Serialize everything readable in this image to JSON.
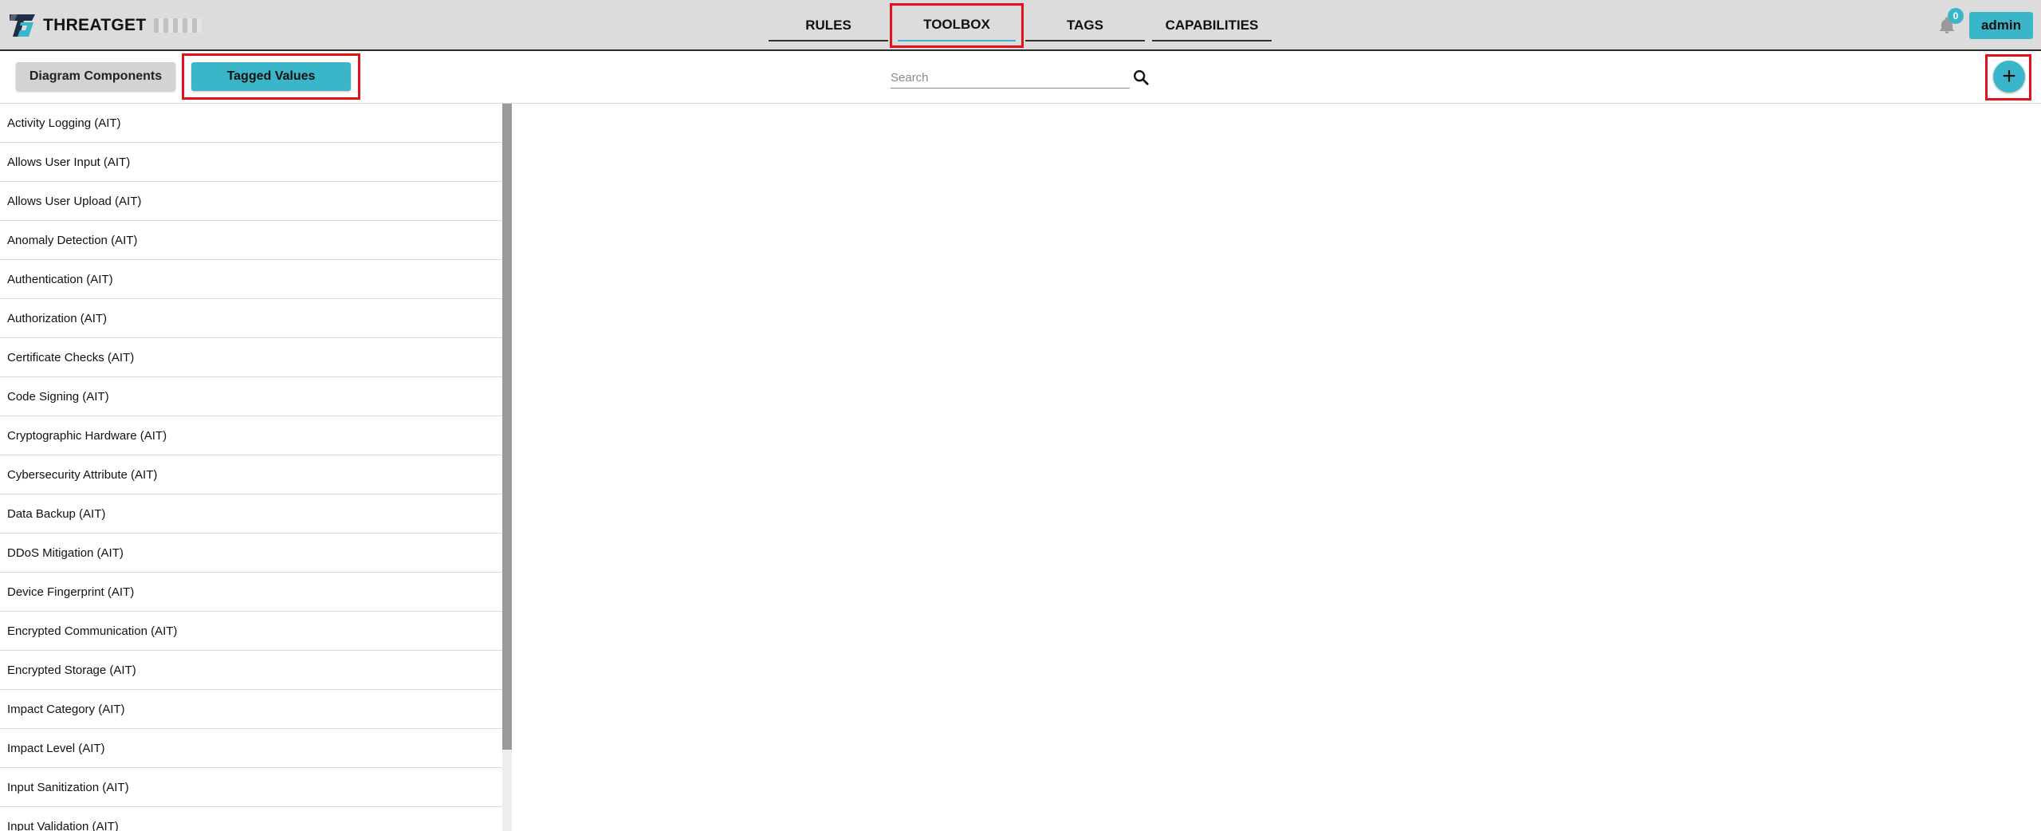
{
  "app": {
    "name": "THREATGET"
  },
  "nav": {
    "tabs": [
      {
        "label": "RULES",
        "active": false
      },
      {
        "label": "TOOLBOX",
        "active": true
      },
      {
        "label": "TAGS",
        "active": false
      },
      {
        "label": "CAPABILITIES",
        "active": false
      }
    ]
  },
  "header": {
    "notification_count": "0",
    "user_label": "admin"
  },
  "toolbar": {
    "tabs": [
      {
        "label": "Diagram Components",
        "active": false
      },
      {
        "label": "Tagged Values",
        "active": true
      }
    ],
    "search_placeholder": "Search",
    "add_label": "+"
  },
  "tagged_values": {
    "items": [
      "Activity Logging (AIT)",
      "Allows User Input (AIT)",
      "Allows User Upload (AIT)",
      "Anomaly Detection (AIT)",
      "Authentication (AIT)",
      "Authorization (AIT)",
      "Certificate Checks (AIT)",
      "Code Signing (AIT)",
      "Cryptographic Hardware (AIT)",
      "Cybersecurity Attribute (AIT)",
      "Data Backup (AIT)",
      "DDoS Mitigation (AIT)",
      "Device Fingerprint (AIT)",
      "Encrypted Communication (AIT)",
      "Encrypted Storage (AIT)",
      "Impact Category (AIT)",
      "Impact Level (AIT)",
      "Input Sanitization (AIT)",
      "Input Validation (AIT)"
    ]
  },
  "colors": {
    "accent": "#3ab6c8",
    "highlight": "#e0131b",
    "topbar": "#dcdcdc"
  },
  "icons": {
    "logo": "threatget-logo-icon",
    "notification": "bell-icon",
    "search": "search-icon",
    "add": "plus-icon"
  }
}
